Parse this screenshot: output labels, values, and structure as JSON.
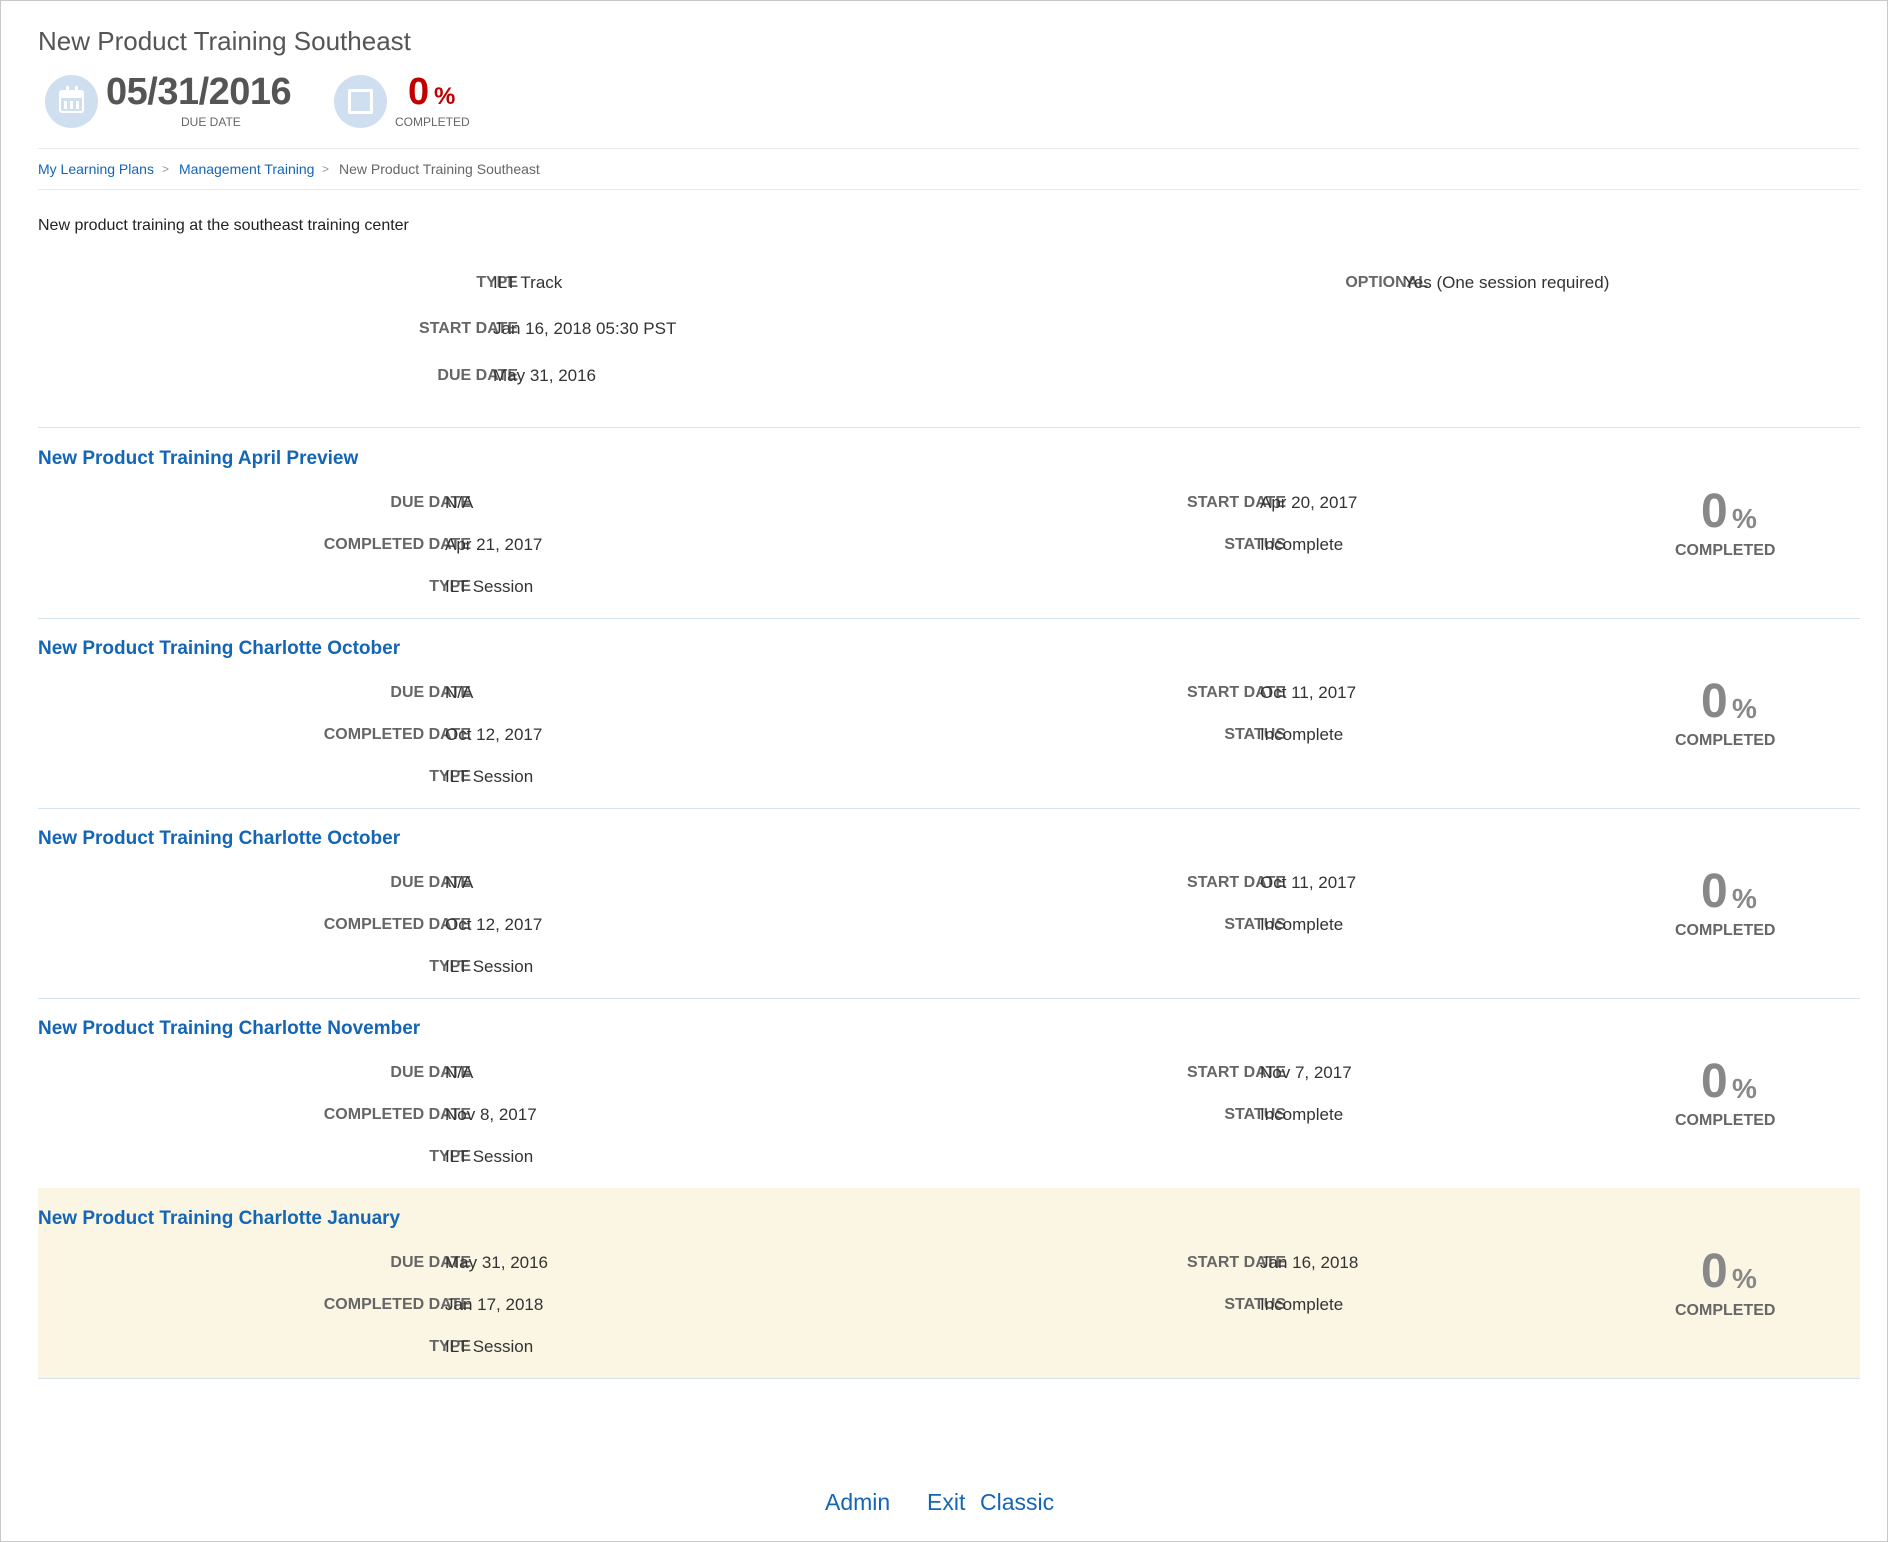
{
  "header": {
    "title": "New Product Training Southeast",
    "due_date": {
      "value": "05/31/2016",
      "caption": "DUE DATE"
    },
    "completion": {
      "value": "0",
      "unit": "%",
      "caption": "COMPLETED"
    }
  },
  "breadcrumb": {
    "items": [
      {
        "label": "My Learning Plans"
      },
      {
        "label": "Management Training"
      },
      {
        "label": "New Product Training Southeast"
      }
    ],
    "separator": ">"
  },
  "description": "New product training at the southeast training center",
  "details": {
    "type": {
      "label": "TYPE",
      "value": "ILT Track"
    },
    "start_date": {
      "label": "START DATE",
      "value": "Jan 16, 2018 05:30 PST"
    },
    "due_date": {
      "label": "DUE DATE",
      "value": "May 31, 2016"
    },
    "optional": {
      "label": "OPTIONAL",
      "value": "Yes (One session required)"
    }
  },
  "labels": {
    "due_date": "DUE DATE",
    "completed_date": "COMPLETED DATE",
    "type": "TYPE",
    "start_date": "START DATE",
    "status": "STATUS",
    "completed": "COMPLETED",
    "percent": "%"
  },
  "sessions": [
    {
      "title": "New Product Training April Preview",
      "due_date": "N/A",
      "completed_date": "Apr 21, 2017",
      "type": "ILT Session",
      "start_date": "Apr 20, 2017",
      "status": "Incomplete",
      "percent": "0",
      "highlighted": false
    },
    {
      "title": "New Product Training Charlotte October",
      "due_date": "N/A",
      "completed_date": "Oct 12, 2017",
      "type": "ILT Session",
      "start_date": "Oct 11, 2017",
      "status": "Incomplete",
      "percent": "0",
      "highlighted": false
    },
    {
      "title": "New Product Training Charlotte October",
      "due_date": "N/A",
      "completed_date": "Oct 12, 2017",
      "type": "ILT Session",
      "start_date": "Oct 11, 2017",
      "status": "Incomplete",
      "percent": "0",
      "highlighted": false
    },
    {
      "title": "New Product Training Charlotte November",
      "due_date": "N/A",
      "completed_date": "Nov 8, 2017",
      "type": "ILT Session",
      "start_date": "Nov 7, 2017",
      "status": "Incomplete",
      "percent": "0",
      "highlighted": false
    },
    {
      "title": "New Product Training Charlotte January",
      "due_date": "May 31, 2016",
      "completed_date": "Jan 17, 2018",
      "type": "ILT Session",
      "start_date": "Jan 16, 2018",
      "status": "Incomplete",
      "percent": "0",
      "highlighted": true
    }
  ],
  "footer": {
    "links": [
      "Admin",
      "Exit",
      "Classic"
    ]
  },
  "colors": {
    "link": "#1565b5",
    "completion_red": "#c00000",
    "highlight_row": "#fbf6e3",
    "icon_circle": "#cfdff0"
  },
  "icons": {
    "due_date": "calendar-icon",
    "completion": "checkbox-square-icon"
  }
}
